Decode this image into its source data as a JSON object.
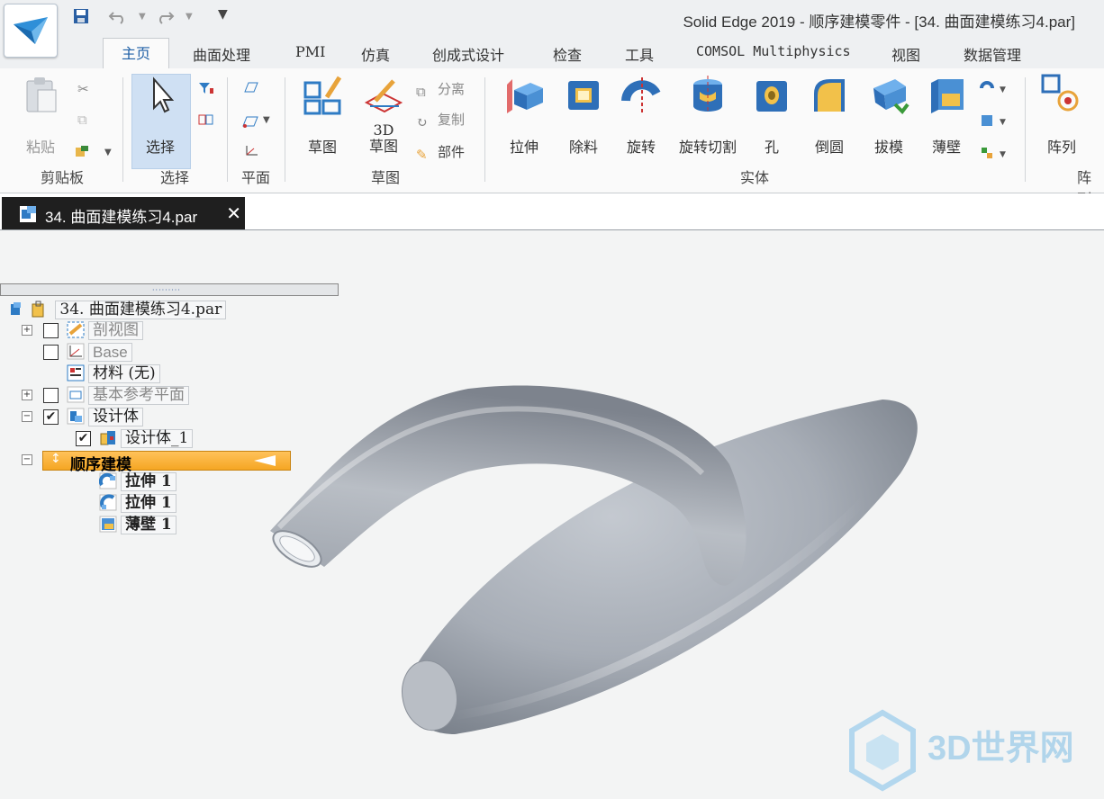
{
  "window": {
    "title": "Solid Edge 2019 - 顺序建模零件 - [34. 曲面建模练习4.par]"
  },
  "tabs": [
    "主页",
    "曲面处理",
    "PMI",
    "仿真",
    "创成式设计",
    "检查",
    "工具",
    "COMSOL Multiphysics",
    "视图",
    "数据管理"
  ],
  "ribbon": {
    "clipboard": {
      "paste": "粘贴",
      "group": "剪贴板"
    },
    "select": {
      "select": "选择",
      "group": "选择"
    },
    "plane": {
      "group": "平面"
    },
    "sketch": {
      "sketch": "草图",
      "sketch3d_top": "3D",
      "sketch3d_bottom": "草图",
      "group": "草图",
      "split": "分离",
      "copy": "复制",
      "part": "部件"
    },
    "solid": {
      "extrude": "拉伸",
      "cut": "除料",
      "revolve": "旋转",
      "revolve_cut": "旋转切割",
      "hole": "孔",
      "round": "倒圆",
      "draft": "拔模",
      "thin_wall": "薄壁",
      "group": "实体"
    },
    "pattern": {
      "pattern": "阵列",
      "group": "阵列"
    }
  },
  "document_tab": {
    "label": "34. 曲面建模练习4.par",
    "close": "✕"
  },
  "pathfinder": {
    "root": "34. 曲面建模练习4.par",
    "section_view": "剖视图",
    "base": "Base",
    "material": "材料 (无)",
    "ref_planes": "基本参考平面",
    "design_body": "设计体",
    "design_body_1": "设计体_1",
    "ordered": "顺序建模",
    "features": [
      "拉伸 1",
      "拉伸 1",
      "薄壁 1"
    ]
  },
  "colors": {
    "accent": "#1e5fa6",
    "active_node": "#f5a623",
    "part": "#a7adb6"
  },
  "watermark": "3D世界网"
}
